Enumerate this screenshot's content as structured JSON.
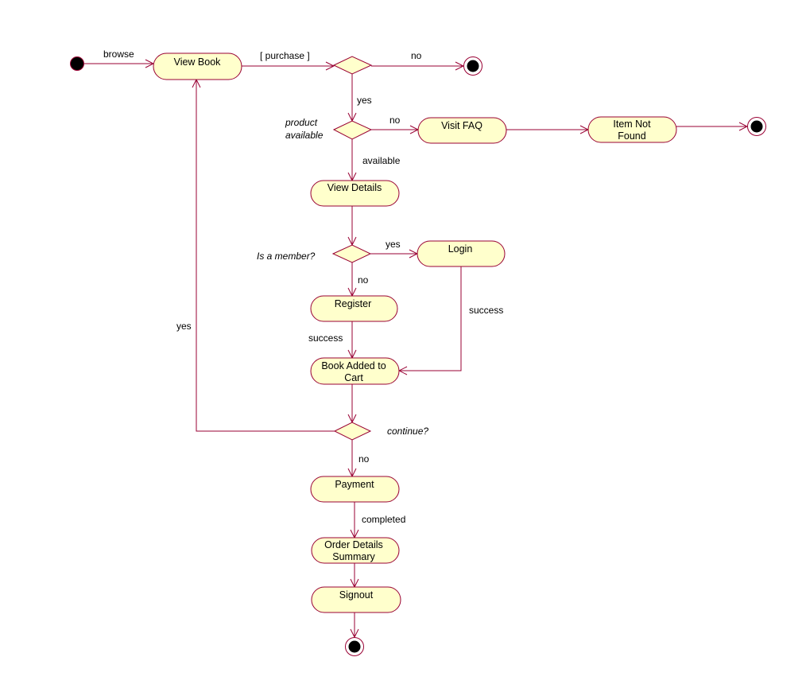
{
  "colors": {
    "stroke": "#990033",
    "fill": "#ffffcc",
    "terminal": "#000000"
  },
  "activities": {
    "view_book": "View Book",
    "visit_faq": "Visit FAQ",
    "item_not_found": [
      "Item Not",
      "Found"
    ],
    "view_details": "View Details",
    "login": "Login",
    "register": "Register",
    "book_added": [
      "Book Added to",
      "Cart"
    ],
    "payment": "Payment",
    "order_summary": [
      "Order Details",
      "Summary"
    ],
    "signout": "Signout"
  },
  "decisions": {
    "product_available": [
      "product",
      "available"
    ],
    "is_member": "Is a member?",
    "continue": "continue?"
  },
  "transitions": {
    "browse": "browse",
    "purchase": "[ purchase ]",
    "purchase_no": "no",
    "purchase_yes": "yes",
    "product_no": "no",
    "available": "available",
    "member_yes": "yes",
    "member_no": "no",
    "login_success": "success",
    "register_success": "success",
    "continue_yes": "yes",
    "continue_no": "no",
    "completed": "completed"
  }
}
